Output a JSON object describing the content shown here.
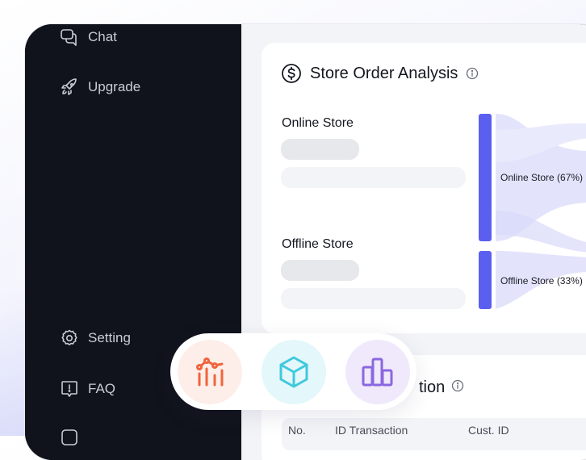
{
  "sidebar": {
    "items": [
      {
        "label": "Chat",
        "icon": "chat-icon"
      },
      {
        "label": "Upgrade",
        "icon": "rocket-icon"
      },
      {
        "label": "Setting",
        "icon": "gear-icon"
      },
      {
        "label": "FAQ",
        "icon": "faq-icon"
      }
    ]
  },
  "store_card": {
    "title": "Store Order Analysis",
    "stores": [
      {
        "label": "Online Store"
      },
      {
        "label": "Offline Store"
      }
    ],
    "nodes": [
      {
        "label": "Online Store (67%)",
        "share": 67
      },
      {
        "label": "Offline Store (33%)",
        "share": 33
      }
    ]
  },
  "transactions_card": {
    "title_fragment": "tion",
    "columns": [
      "No.",
      "ID Transaction",
      "Cust. ID"
    ]
  },
  "floating_toolbar": {
    "icons": [
      {
        "name": "line-chart-icon",
        "color": "#f0643c",
        "bg": "#fdeee9"
      },
      {
        "name": "cube-icon",
        "color": "#3fc9dc",
        "bg": "#e4f7fa"
      },
      {
        "name": "bar-chart-icon",
        "color": "#8b67e0",
        "bg": "#efe9fb"
      }
    ]
  },
  "colors": {
    "accent": "#5b5ff0",
    "flow": "#dfe0fb"
  }
}
